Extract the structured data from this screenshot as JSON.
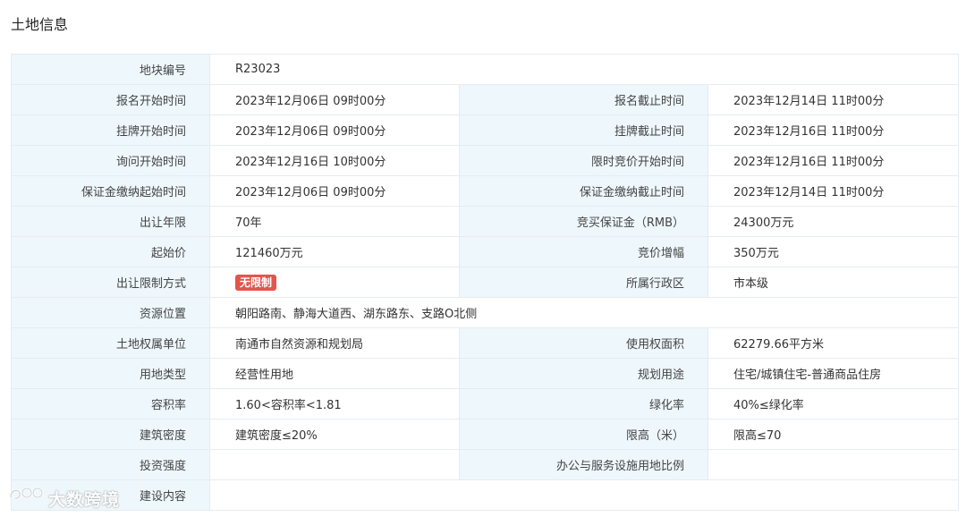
{
  "section_title": "土地信息",
  "colors": {
    "label_bg": "#eef7fc",
    "border": "#e6ecf0",
    "tag_bg": "#e2554c"
  },
  "rows": [
    {
      "label": "地块编号",
      "value": "R23023"
    },
    {
      "label": "报名开始时间",
      "value": "2023年12月06日 09时00分",
      "label2": "报名截止时间",
      "value2": "2023年12月14日 11时00分"
    },
    {
      "label": "挂牌开始时间",
      "value": "2023年12月06日 09时00分",
      "label2": "挂牌截止时间",
      "value2": "2023年12月16日 11时00分"
    },
    {
      "label": "询问开始时间",
      "value": "2023年12月16日 10时00分",
      "label2": "限时竞价开始时间",
      "value2": "2023年12月16日 11时00分"
    },
    {
      "label": "保证金缴纳起始时间",
      "value": "2023年12月06日 09时00分",
      "label2": "保证金缴纳截止时间",
      "value2": "2023年12月14日 11时00分"
    },
    {
      "label": "出让年限",
      "value": "70年",
      "label2": "竞买保证金（RMB）",
      "value2": "24300万元"
    },
    {
      "label": "起始价",
      "value": "121460万元",
      "label2": "竞价增幅",
      "value2": "350万元"
    },
    {
      "label": "出让限制方式",
      "value": "无限制",
      "label2": "所属行政区",
      "value2": "市本级"
    },
    {
      "label": "资源位置",
      "value": "朝阳路南、静海大道西、湖东路东、支路O北侧"
    },
    {
      "label": "土地权属单位",
      "value": "南通市自然资源和规划局",
      "label2": "使用权面积",
      "value2": "62279.66平方米"
    },
    {
      "label": "用地类型",
      "value": "经营性用地",
      "label2": "规划用途",
      "value2": "住宅/城镇住宅-普通商品住房"
    },
    {
      "label": "容积率",
      "value": "1.60<容积率<1.81",
      "label2": "绿化率",
      "value2": "40%≤绿化率"
    },
    {
      "label": "建筑密度",
      "value": "建筑密度≤20%",
      "label2": "限高（米）",
      "value2": "限高≤70"
    },
    {
      "label": "投资强度",
      "value": "",
      "label2": "办公与服务设施用地比例",
      "value2": ""
    },
    {
      "label": "建设内容",
      "value": ""
    }
  ],
  "watermark": {
    "text": "大数跨境",
    "icon": "brand-logo-icon"
  }
}
